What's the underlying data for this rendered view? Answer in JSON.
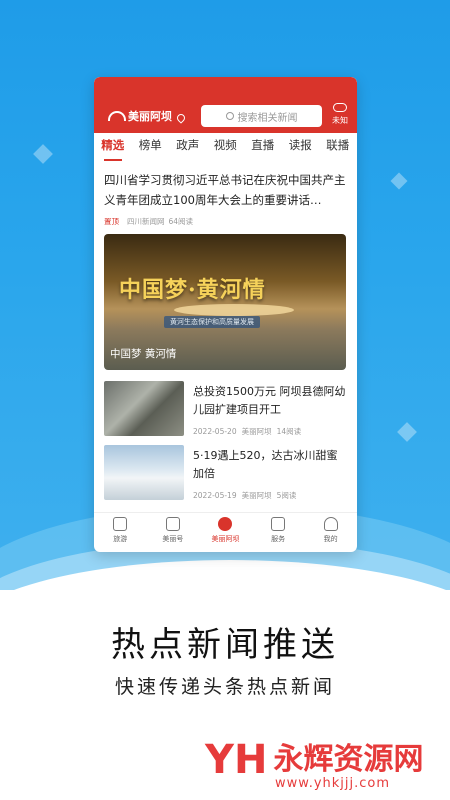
{
  "app": {
    "logo_text": "美丽阿坝",
    "search_placeholder": "搜索相关新闻",
    "weather_label": "未知",
    "tabs": [
      "精选",
      "榜单",
      "政声",
      "视频",
      "直播",
      "读报",
      "联播"
    ],
    "active_tab": "精选"
  },
  "feed": {
    "top_story": {
      "title": "四川省学习贯彻习近平总书记在庆祝中国共产主义青年团成立100周年大会上的重要讲话…",
      "tag": "置顶",
      "source": "四川新闻网",
      "reads": "64阅读"
    },
    "banner": {
      "big_text": "中国梦·黄河情",
      "sub_text": "黄河生态保护和高质量发展",
      "caption": "中国梦 黄河情"
    },
    "items": [
      {
        "title": "总投资1500万元 阿坝县德阿幼儿园扩建项目开工",
        "date": "2022-05-20",
        "source": "美丽阿坝",
        "reads": "14阅读"
      },
      {
        "title": "5·19遇上520，达古冰川甜蜜加倍",
        "date": "2022-05-19",
        "source": "美丽阿坝",
        "reads": "5阅读"
      }
    ]
  },
  "bottom_nav": [
    "旅游",
    "美丽号",
    "美丽阿坝",
    "服务",
    "我的"
  ],
  "promo": {
    "slogan": "热点新闻推送",
    "subslogan": "快速传递头条热点新闻"
  },
  "watermark": {
    "logo": "YH",
    "name": "永辉资源网",
    "url": "www.yhkjjj.com"
  },
  "colors": {
    "accent_red": "#d9342b",
    "background_blue": "#2aa6ec"
  }
}
